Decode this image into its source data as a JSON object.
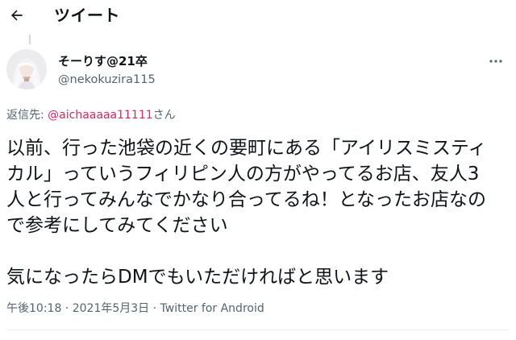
{
  "header": {
    "title": "ツイート",
    "back_icon": "arrow-left-icon"
  },
  "author": {
    "display_name": "そーりす@21卒",
    "handle": "@nekokuzira115",
    "avatar": "avatar-image"
  },
  "more_icon": "more-horizontal-icon",
  "reply": {
    "prefix": "返信先: ",
    "mention": "@aichaaaaa11111",
    "suffix": "さん"
  },
  "tweet": {
    "text": "以前、行った池袋の近くの要町にある「アイリスミスティカル」っていうフィリピン人の方がやってるお店、友人3人と行ってみんなでかなり合ってるね！となったお店なので参考にしてみてください\n\n気になったらDMでもいただければと思います"
  },
  "meta": {
    "time": "午後10:18",
    "separator": " · ",
    "date": "2021年5月3日",
    "client": "Twitter for Android"
  },
  "colors": {
    "text": "#0f1419",
    "secondary": "#536471",
    "mention": "#e0245e",
    "divider": "#eff3f4"
  }
}
